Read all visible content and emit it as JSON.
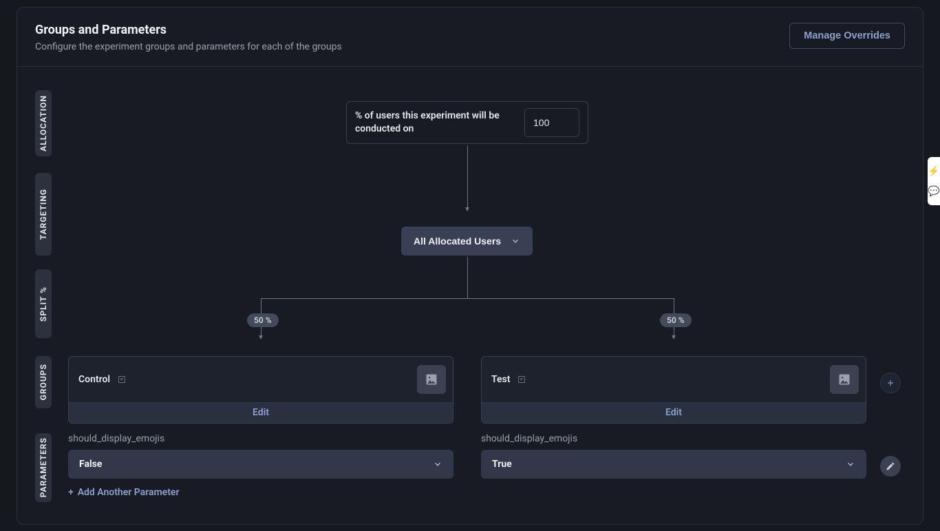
{
  "header": {
    "title": "Groups and Parameters",
    "subtitle": "Configure the experiment groups and parameters for each of the groups",
    "manage_overrides": "Manage Overrides"
  },
  "side_labels": {
    "allocation": "ALLOCATION",
    "targeting": "TARGETING",
    "split": "SPLIT %",
    "groups": "GROUPS",
    "parameters": "PARAMETERS"
  },
  "allocation": {
    "label": "% of users this experiment will be conducted on",
    "value": "100"
  },
  "targeting": {
    "selected": "All Allocated Users"
  },
  "split": {
    "left": "50 %",
    "right": "50 %"
  },
  "groups": {
    "control": {
      "name": "Control",
      "edit": "Edit"
    },
    "test": {
      "name": "Test",
      "edit": "Edit"
    }
  },
  "parameters": {
    "name": "should_display_emojis",
    "control_value": "False",
    "test_value": "True",
    "add": "Add Another Parameter"
  }
}
